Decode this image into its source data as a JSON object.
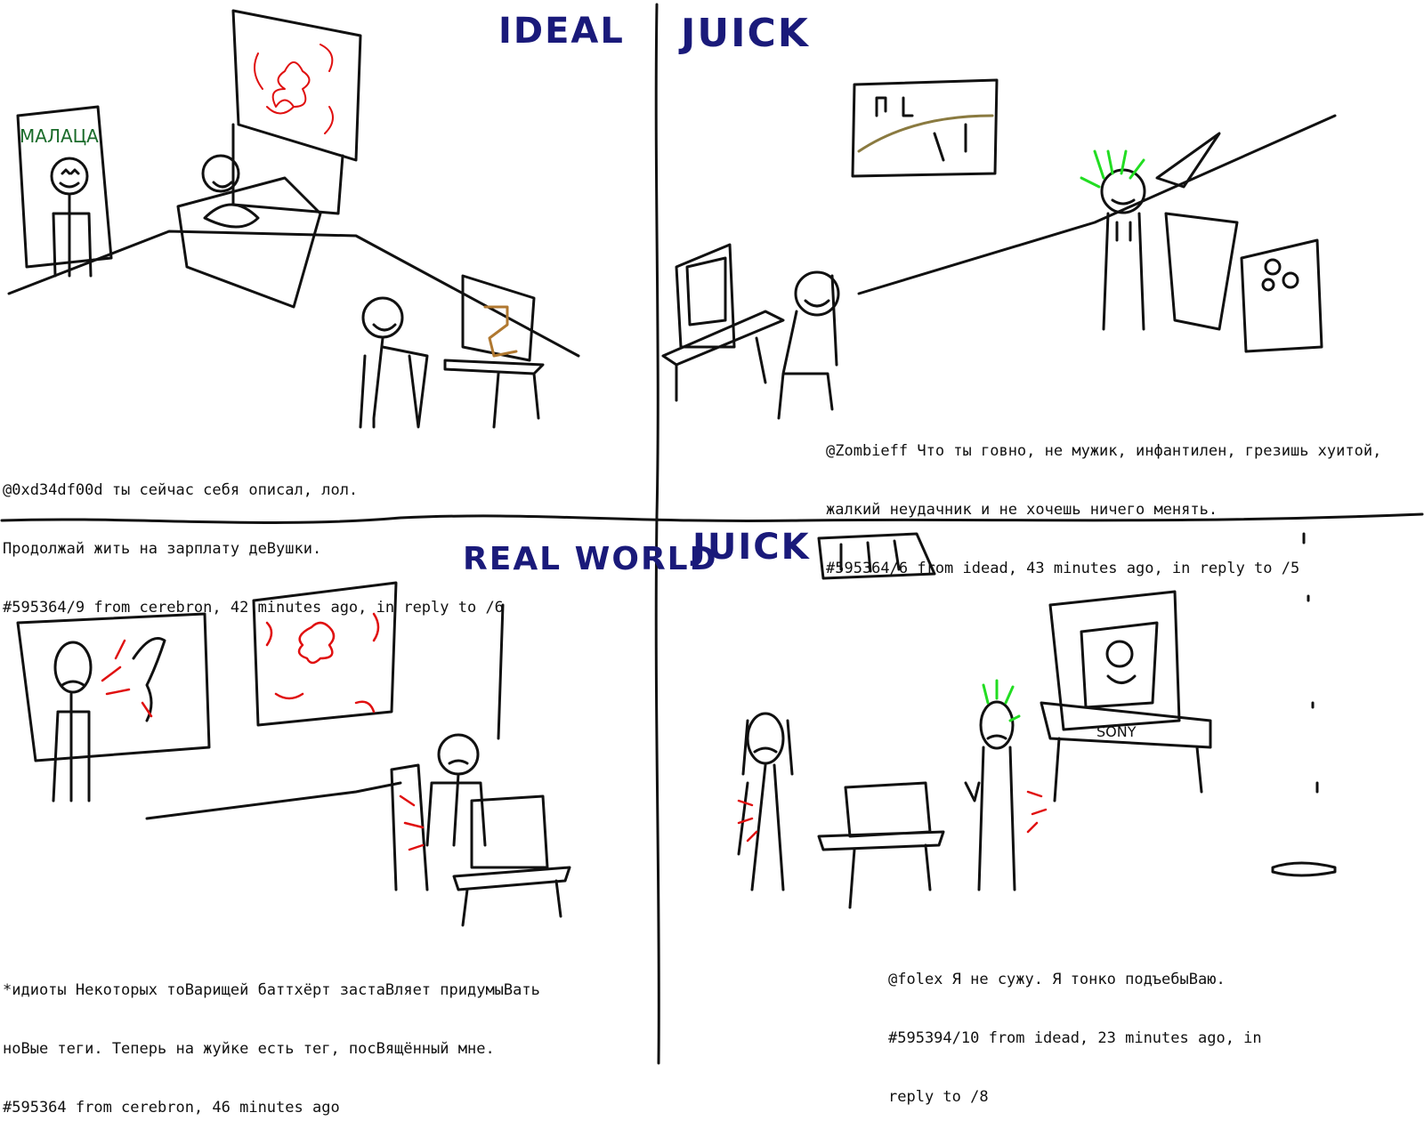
{
  "panels": {
    "top_left": {
      "heading": "IDEAL",
      "sign": "МАЛАЦА",
      "caption": [
        "@0xd34df00d ты сейчас себя описал, лол.",
        "Продолжай жить на зарплату деВушки.",
        "#595364/9 from cerebron, 42 minutes ago, in reply to /6"
      ]
    },
    "top_right": {
      "heading": "JUICK",
      "caption": [
        "@Zombieff Что ты говно, не мужик, инфантилен, грезишь хуитой,",
        "жалкий неудачник и не хочешь ничего менять.",
        "#595364/6 from idead, 43 minutes ago, in reply to /5"
      ]
    },
    "bottom_left": {
      "heading": "REAL WORLD",
      "caption": [
        "*идиоты Некоторых тоВарищей баттхёрт застаВляет придумыВать",
        "ноВые теги. Теперь на жуйке есть тег, посВящённый мне.",
        "#595364 from cerebron, 46 minutes ago"
      ]
    },
    "bottom_right": {
      "heading": "JUICK",
      "tv_brand": "SONY",
      "caption": [
        "@folex Я не сужу. Я тонко подъебыВаю.",
        "#595394/10 from idead, 23 minutes ago, in",
        "reply to /8"
      ]
    }
  },
  "colors": {
    "ink": "#111111",
    "heading": "#1a1a7a",
    "accent_red": "#e01010",
    "hair_green": "#22dd22",
    "sign_green": "#1a6b2a"
  }
}
